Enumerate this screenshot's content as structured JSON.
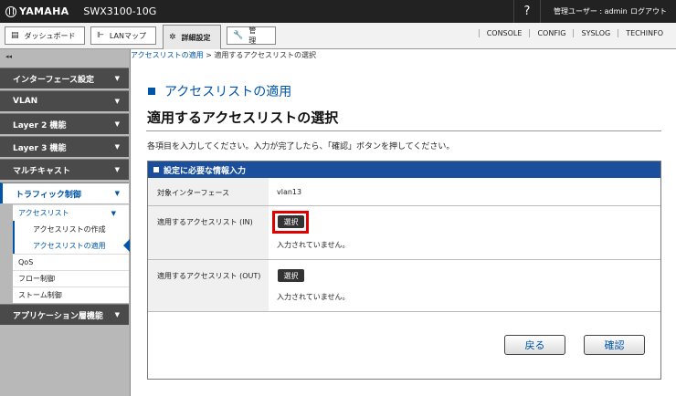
{
  "header": {
    "brand": "YAMAHA",
    "model": "SWX3100-10G",
    "help": "?",
    "user": "管理ユーザー : admin",
    "logout": "ログアウト"
  },
  "tabs": {
    "dashboard": "ダッシュボード",
    "lanmap": "LANマップ",
    "advanced": "詳細設定",
    "management": "管　理",
    "right_links": [
      "CONSOLE",
      "CONFIG",
      "SYSLOG",
      "TECHINFO"
    ]
  },
  "sidebar": {
    "collapse": "◂◂",
    "menus": [
      "インターフェース設定",
      "VLAN",
      "Layer 2 機能",
      "Layer 3 機能",
      "マルチキャスト"
    ],
    "traffic": "トラフィック制御",
    "acl": "アクセスリスト",
    "acl_create": "アクセスリストの作成",
    "acl_apply": "アクセスリストの適用",
    "qos": "QoS",
    "flow": "フロー制御",
    "storm": "ストーム制御",
    "app": "アプリケーション層機能",
    "arrow": "▼"
  },
  "breadcrumb": {
    "link": "アクセスリストの適用",
    "sep": " > ",
    "current": "適用するアクセスリストの選択"
  },
  "main": {
    "section_title": "アクセスリストの適用",
    "page_title": "適用するアクセスリストの選択",
    "instruction": "各項目を入力してください。入力が完了したら、「確認」ボタンを押してください。"
  },
  "form": {
    "heading": "設定に必要な情報入力",
    "interface_label": "対象インターフェース",
    "interface_value": "vlan13",
    "acl_in_label": "適用するアクセスリスト (IN)",
    "acl_out_label": "適用するアクセスリスト (OUT)",
    "select_label": "選択",
    "not_entered": "入力されていません。",
    "back": "戻る",
    "confirm": "確認"
  },
  "colors": {
    "accent": "#0055a8",
    "panel_header": "#1b4f9c",
    "highlight": "#e00000"
  }
}
